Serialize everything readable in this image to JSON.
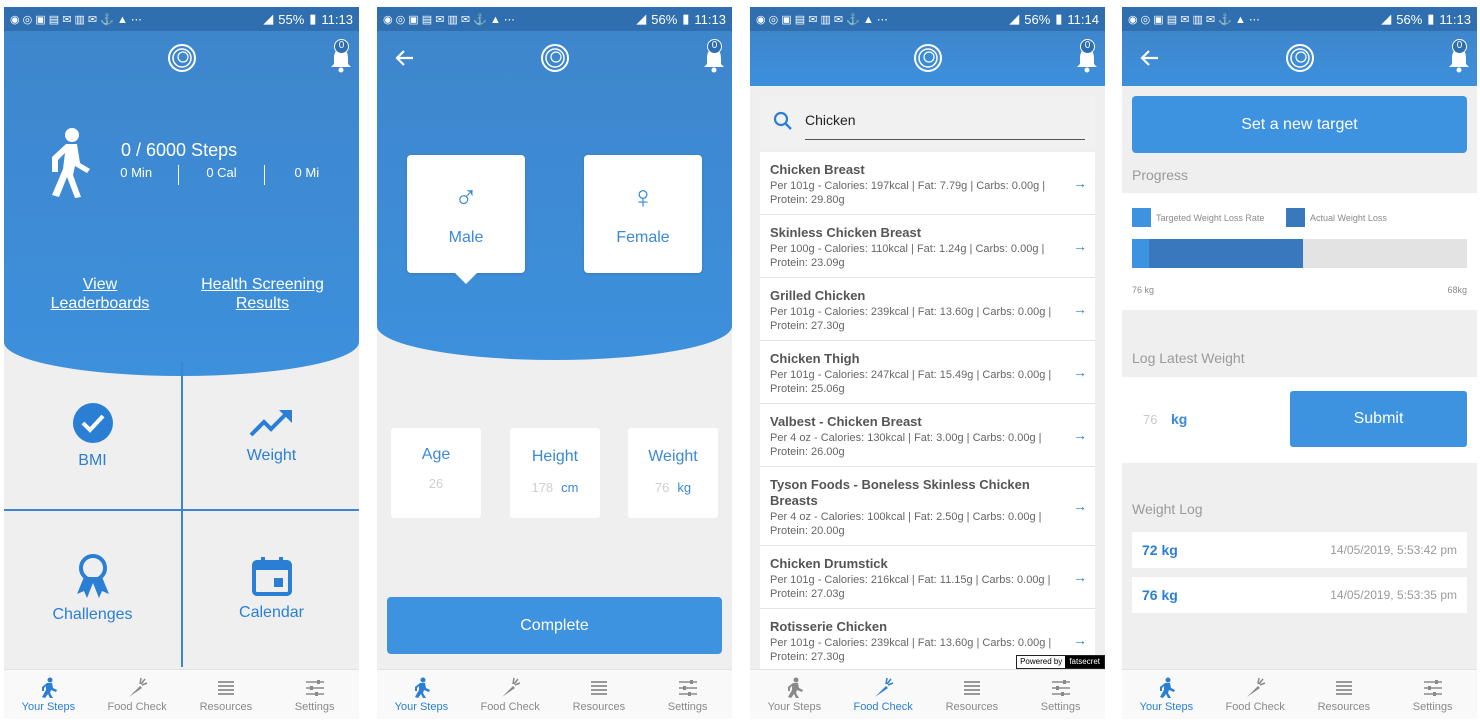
{
  "status_bars": [
    {
      "battery": "55%",
      "time": "11:13"
    },
    {
      "battery": "56%",
      "time": "11:13"
    },
    {
      "battery": "56%",
      "time": "11:14"
    },
    {
      "battery": "56%",
      "time": "11:13"
    }
  ],
  "notification_count": "0",
  "tabs": [
    {
      "label": "Your Steps",
      "icon": "walker-icon"
    },
    {
      "label": "Food Check",
      "icon": "carrot-icon"
    },
    {
      "label": "Resources",
      "icon": "list-icon"
    },
    {
      "label": "Settings",
      "icon": "sliders-icon"
    }
  ],
  "steps_screen": {
    "steps": "0 / 6000 Steps",
    "minutes": "0 Min",
    "calories": "0 Cal",
    "miles": "0 Mi",
    "link_leaderboards": "View Leaderboards",
    "link_health": "Health Screening Results",
    "tiles": [
      "BMI",
      "Weight",
      "Challenges",
      "Calendar"
    ]
  },
  "profile_screen": {
    "male": "Male",
    "female": "Female",
    "age_label": "Age",
    "age_value": "26",
    "height_label": "Height",
    "height_value": "178",
    "height_unit": "cm",
    "weight_label": "Weight",
    "weight_value": "76",
    "weight_unit": "kg",
    "complete": "Complete"
  },
  "food_screen": {
    "search_value": "Chicken",
    "results": [
      {
        "name": "Chicken Breast",
        "desc": "Per 101g - Calories: 197kcal | Fat: 7.79g | Carbs: 0.00g | Protein: 29.80g"
      },
      {
        "name": "Skinless Chicken Breast",
        "desc": "Per 100g - Calories: 110kcal | Fat: 1.24g | Carbs: 0.00g | Protein: 23.09g"
      },
      {
        "name": "Grilled Chicken",
        "desc": "Per 101g - Calories: 239kcal | Fat: 13.60g | Carbs: 0.00g | Protein: 27.30g"
      },
      {
        "name": "Chicken Thigh",
        "desc": "Per 101g - Calories: 247kcal | Fat: 15.49g | Carbs: 0.00g | Protein: 25.06g"
      },
      {
        "name": "Valbest - Chicken Breast",
        "desc": "Per 4 oz - Calories: 130kcal | Fat: 3.00g | Carbs: 0.00g | Protein: 26.00g"
      },
      {
        "name": "Tyson Foods - Boneless Skinless Chicken Breasts",
        "desc": "Per 4 oz - Calories: 100kcal | Fat: 2.50g | Carbs: 0.00g | Protein: 20.00g"
      },
      {
        "name": "Chicken Drumstick",
        "desc": "Per 101g - Calories: 216kcal | Fat: 11.15g | Carbs: 0.00g | Protein: 27.03g"
      },
      {
        "name": "Rotisserie Chicken",
        "desc": "Per 101g - Calories: 239kcal | Fat: 13.60g | Carbs: 0.00g | Protein: 27.30g"
      }
    ],
    "powered_by": "Powered by",
    "powered_brand": "fatsecret"
  },
  "weight_screen": {
    "set_target": "Set a new target",
    "progress_label": "Progress",
    "legend_target": "Targeted Weight Loss Rate",
    "legend_actual": "Actual Weight Loss",
    "target_fraction": 0.05,
    "actual_fraction": 0.51,
    "start_kg": "76 kg",
    "goal_kg": "68kg",
    "log_label": "Log Latest Weight",
    "log_value": "76",
    "log_unit": "kg",
    "submit": "Submit",
    "weight_log_label": "Weight Log",
    "entries": [
      {
        "weight": "72 kg",
        "date": "14/05/2019, 5:53:42 pm"
      },
      {
        "weight": "76 kg",
        "date": "14/05/2019, 5:53:35 pm"
      }
    ]
  },
  "colors": {
    "accent": "#3d93df",
    "header": "#3e86cc",
    "status_bar": "#2f6fb0",
    "bar_actual": "#3a78bd"
  }
}
